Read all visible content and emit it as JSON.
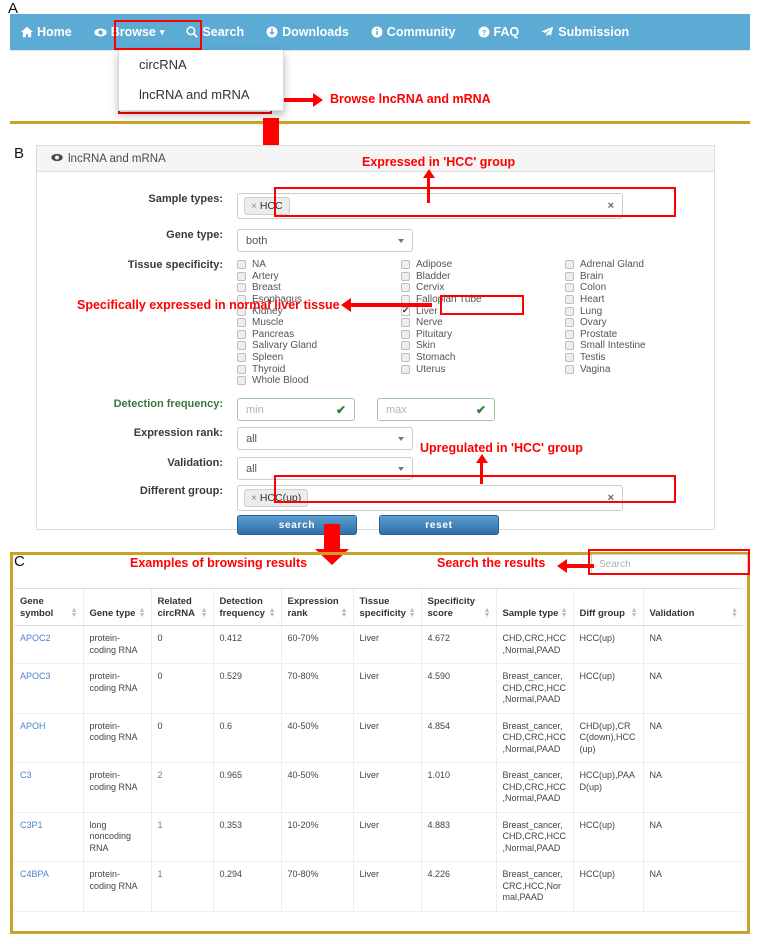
{
  "panels": {
    "a": "A",
    "b": "B",
    "c": "C"
  },
  "navbar": {
    "items": [
      {
        "label": "Home",
        "icon": "home-icon"
      },
      {
        "label": "Browse",
        "icon": "eye-icon",
        "caret": "▾"
      },
      {
        "label": "Search",
        "icon": "magnifier-icon"
      },
      {
        "label": "Downloads",
        "icon": "download-circle-icon"
      },
      {
        "label": "Community",
        "icon": "info-circle-icon"
      },
      {
        "label": "FAQ",
        "icon": "question-circle-icon"
      },
      {
        "label": "Submission",
        "icon": "paper-plane-icon"
      }
    ],
    "dropdown": [
      {
        "label": "circRNA"
      },
      {
        "label": "lncRNA and mRNA"
      }
    ]
  },
  "annotations": {
    "browse": "Browse lncRNA and mRNA",
    "expressed": "Expressed in 'HCC' group",
    "specific": "Specifically expressed in normal liver tissue",
    "upregulated": "Upregulated in 'HCC' group",
    "examples": "Examples of browsing results",
    "search_results": "Search the results"
  },
  "form": {
    "card_title": "lncRNA and mRNA",
    "card_icon": "eye-icon",
    "sample_types": {
      "label": "Sample types:",
      "tokens": [
        "HCC"
      ],
      "remove_glyph": "×",
      "clear_glyph": "×"
    },
    "gene_type": {
      "label": "Gene type:",
      "value": "both"
    },
    "tissue_specificity": {
      "label": "Tissue specificity:",
      "columns": [
        [
          "NA",
          "Artery",
          "Breast",
          "Esophagus",
          "Kidney",
          "Muscle",
          "Pancreas",
          "Salivary Gland",
          "Spleen",
          "Thyroid",
          "Whole Blood"
        ],
        [
          "Adipose",
          "Bladder",
          "Cervix",
          "Fallopian Tube",
          "Liver",
          "Nerve",
          "Pituitary",
          "Skin",
          "Stomach",
          "Uterus"
        ],
        [
          "Adrenal Gland",
          "Brain",
          "Colon",
          "Heart",
          "Lung",
          "Ovary",
          "Prostate",
          "Small Intestine",
          "Testis",
          "Vagina"
        ]
      ],
      "checked": [
        "Liver"
      ]
    },
    "detection_frequency": {
      "label": "Detection frequency:",
      "min_placeholder": "min",
      "max_placeholder": "max",
      "valid_glyph": "✔"
    },
    "expression_rank": {
      "label": "Expression rank:",
      "value": "all"
    },
    "validation": {
      "label": "Validation:",
      "value": "all"
    },
    "different_group": {
      "label": "Different group:",
      "tokens": [
        "HCC(up)"
      ],
      "remove_glyph": "×",
      "clear_glyph": "×"
    },
    "buttons": {
      "search": "search",
      "reset": "reset"
    }
  },
  "results": {
    "search_placeholder": "Search",
    "columns": [
      "Gene symbol",
      "Gene type",
      "Related circRNA",
      "Detection frequency",
      "Expression rank",
      "Tissue specificity",
      "Specificity score",
      "Sample type",
      "Diff group",
      "Validation"
    ],
    "rows": [
      {
        "gene_symbol": "APOC2",
        "gene_type": "protein-coding RNA",
        "related_circrna": "0",
        "detection_frequency": "0.412",
        "expression_rank": "60-70%",
        "tissue_specificity": "Liver",
        "specificity_score": "4.672",
        "sample_type": "CHD,CRC,HCC,Normal,PAAD",
        "diff_group": "HCC(up)",
        "validation": "NA",
        "circrna_link": false
      },
      {
        "gene_symbol": "APOC3",
        "gene_type": "protein-coding RNA",
        "related_circrna": "0",
        "detection_frequency": "0.529",
        "expression_rank": "70-80%",
        "tissue_specificity": "Liver",
        "specificity_score": "4.590",
        "sample_type": "Breast_cancer,CHD,CRC,HCC,Normal,PAAD",
        "diff_group": "HCC(up)",
        "validation": "NA",
        "circrna_link": false
      },
      {
        "gene_symbol": "APOH",
        "gene_type": "protein-coding RNA",
        "related_circrna": "0",
        "detection_frequency": "0.6",
        "expression_rank": "40-50%",
        "tissue_specificity": "Liver",
        "specificity_score": "4.854",
        "sample_type": "Breast_cancer,CHD,CRC,HCC,Normal,PAAD",
        "diff_group": "CHD(up),CRC(down),HCC(up)",
        "validation": "NA",
        "circrna_link": false
      },
      {
        "gene_symbol": "C3",
        "gene_type": "protein-coding RNA",
        "related_circrna": "2",
        "detection_frequency": "0.965",
        "expression_rank": "40-50%",
        "tissue_specificity": "Liver",
        "specificity_score": "1.010",
        "sample_type": "Breast_cancer,CHD,CRC,HCC,Normal,PAAD",
        "diff_group": "HCC(up),PAAD(up)",
        "validation": "NA",
        "circrna_link": true
      },
      {
        "gene_symbol": "C3P1",
        "gene_type": "long noncoding RNA",
        "related_circrna": "1",
        "detection_frequency": "0.353",
        "expression_rank": "10-20%",
        "tissue_specificity": "Liver",
        "specificity_score": "4.883",
        "sample_type": "Breast_cancer,CHD,CRC,HCC,Normal,PAAD",
        "diff_group": "HCC(up)",
        "validation": "NA",
        "circrna_link": true
      },
      {
        "gene_symbol": "C4BPA",
        "gene_type": "protein-coding RNA",
        "related_circrna": "1",
        "detection_frequency": "0.294",
        "expression_rank": "70-80%",
        "tissue_specificity": "Liver",
        "specificity_score": "4.226",
        "sample_type": "Breast_cancer,CRC,HCC,Normal,PAAD",
        "diff_group": "HCC(up)",
        "validation": "NA",
        "circrna_link": true
      }
    ]
  },
  "colors": {
    "nav_blue": "#5cabd5",
    "gold_border": "#c9a227",
    "annotation_red": "#ff0000",
    "button_blue": "#2f6fa8",
    "link_blue": "#4a86c8",
    "green_label": "#3c763d"
  }
}
